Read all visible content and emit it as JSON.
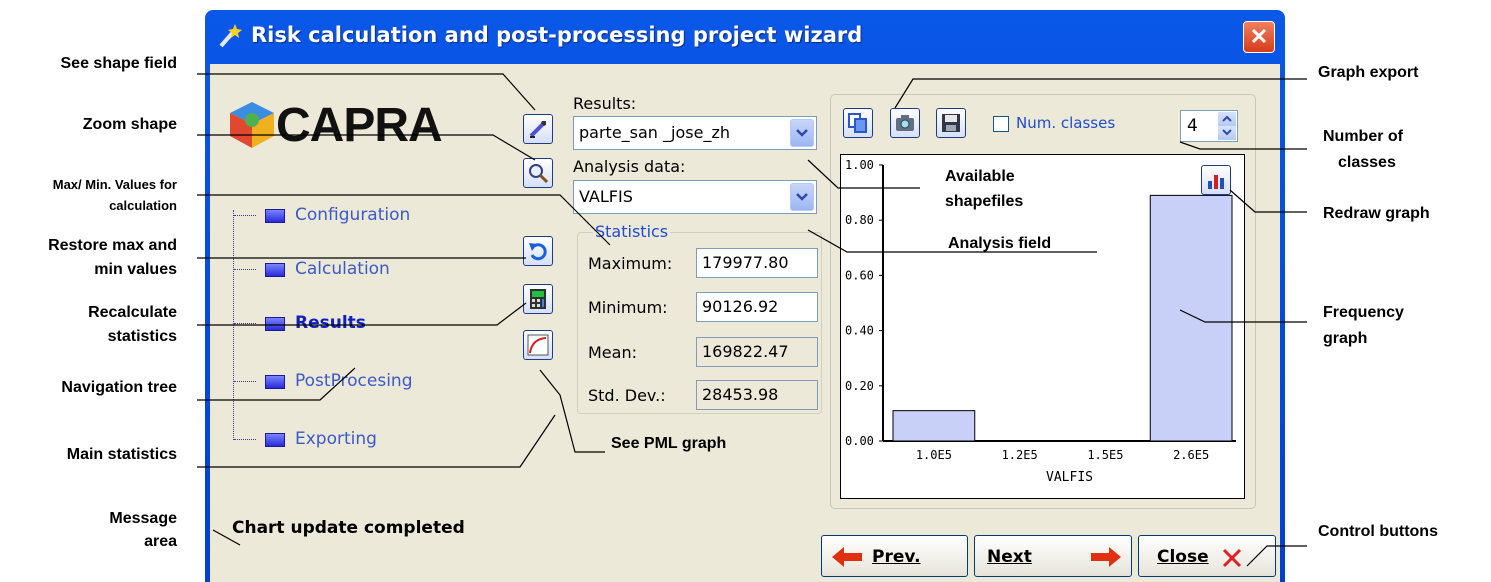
{
  "window": {
    "title": "Risk calculation and post-processing project wizard",
    "close_glyph": "✕"
  },
  "logo": {
    "text": "CAPRA"
  },
  "nav": {
    "items": [
      {
        "label": "Configuration"
      },
      {
        "label": "Calculation"
      },
      {
        "label": "Results",
        "active": true
      },
      {
        "label": "PostProcesing"
      },
      {
        "label": "Exporting"
      }
    ]
  },
  "results": {
    "label": "Results:",
    "selected": "parte_san _jose_zh",
    "analysis_label": "Analysis data:",
    "analysis_selected": "VALFIS"
  },
  "statistics": {
    "title": "Statistics",
    "rows": [
      {
        "label": "Maximum:",
        "value": "179977.80"
      },
      {
        "label": "Minimum:",
        "value": "90126.92"
      },
      {
        "label": "Mean:",
        "value": "169822.47"
      },
      {
        "label": "Std. Dev.:",
        "value": "28453.98"
      }
    ]
  },
  "graph_toolbar": {
    "num_classes_label": "Num. classes",
    "num_classes_value": "4"
  },
  "chart_data": {
    "type": "bar",
    "categories": [
      "1.0E5",
      "1.2E5",
      "1.5E5",
      "2.6E5"
    ],
    "values": [
      0.11,
      0.0,
      0.0,
      0.89
    ],
    "xlabel": "VALFIS",
    "ylabel": "",
    "ylim": [
      0,
      1
    ],
    "yticks": [
      "1.00",
      "0.80",
      "0.60",
      "0.40",
      "0.20",
      "0.00"
    ],
    "bar_color": "#c8d0f8"
  },
  "message": "Chart update completed",
  "buttons": {
    "prev": "Prev.",
    "next": "Next",
    "close": "Close"
  },
  "callouts": {
    "see_shape_field": "See shape field",
    "zoom_shape": "Zoom shape",
    "max_min_1": "Max/ Min. Values for",
    "max_min_2": "calculation",
    "restore_1": "Restore max and",
    "restore_2": "min values",
    "recalc_1": "Recalculate",
    "recalc_2": "statistics",
    "nav_tree": "Navigation tree",
    "main_stats": "Main statistics",
    "message_1": "Message",
    "message_2": "area",
    "graph_export": "Graph export",
    "num_classes_1": "Number of",
    "num_classes_2": "classes",
    "available_1": "Available",
    "available_2": "shapefiles",
    "redraw": "Redraw graph",
    "analysis_field": "Analysis field",
    "freq_1": "Frequency",
    "freq_2": "graph",
    "pml": "See PML graph",
    "control": "Control buttons"
  }
}
